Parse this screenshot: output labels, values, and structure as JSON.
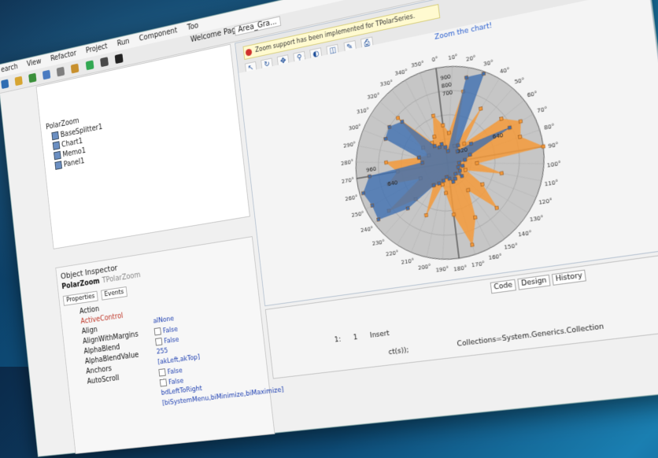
{
  "menu": [
    "earch",
    "View",
    "Refactor",
    "Project",
    "Run",
    "Component",
    "Too"
  ],
  "tabs": {
    "welcome": "Welcome Page",
    "area": "Area_Gra..."
  },
  "tree": {
    "root": "PolarZoom",
    "items": [
      "BaseSplitter1",
      "Chart1",
      "Memo1",
      "Panel1"
    ]
  },
  "inspector": {
    "title": "Object Inspector",
    "object_name": "PolarZoom",
    "object_type": "TPolarZoom",
    "tab_properties": "Properties",
    "tab_events": "Events",
    "properties": [
      {
        "name": "Action",
        "value": ""
      },
      {
        "name": "ActiveControl",
        "value": ""
      },
      {
        "name": "Align",
        "value": "alNone"
      },
      {
        "name": "AlignWithMargins",
        "value": "False"
      },
      {
        "name": "AlphaBlend",
        "value": "False"
      },
      {
        "name": "AlphaBlendValue",
        "value": "255"
      },
      {
        "name": "Anchors",
        "value": "[akLeft,akTop]"
      },
      {
        "name": "AutoScroll",
        "value": "False"
      },
      {
        "name": "",
        "value": "False"
      },
      {
        "name": "",
        "value": "bdLeftToRight"
      },
      {
        "name": "",
        "value": "[biSystemMenu,biMinimize,biMaximize]"
      }
    ]
  },
  "design": {
    "notice": "Zoom support has been implemented for TPolarSeries.",
    "zoom_title": "Zoom the chart!"
  },
  "bottom": {
    "tab_code": "Code",
    "tab_design": "Design",
    "tab_history": "History",
    "line": "1:",
    "col": "1",
    "mode": "Insert",
    "code": "ct(s));",
    "code2": "Collections=System.Generics.Collection"
  },
  "colors": {
    "orange": "#f59a3a",
    "blue": "#3f6fb0"
  },
  "chart_data": {
    "type": "polar",
    "title": "Zoom the chart!",
    "angle_labels": [
      "0°",
      "10°",
      "20°",
      "30°",
      "40°",
      "50°",
      "60°",
      "70°",
      "80°",
      "90°",
      "100°",
      "110°",
      "120°",
      "130°",
      "140°",
      "150°",
      "160°",
      "170°",
      "180°",
      "190°",
      "200°",
      "210°",
      "220°",
      "230°",
      "240°",
      "250°",
      "260°",
      "270°",
      "280°",
      "290°",
      "300°",
      "310°",
      "320°",
      "330°",
      "340°",
      "350°"
    ],
    "radial_labels": [
      "960",
      "900",
      "800",
      "700",
      "640",
      "320"
    ],
    "rmax": 960,
    "series": [
      {
        "color": "#f59a3a",
        "angles": [
          0,
          10,
          20,
          30,
          40,
          50,
          60,
          70,
          80,
          90,
          100,
          110,
          120,
          130,
          140,
          150,
          160,
          170,
          180,
          190,
          200,
          210,
          220,
          230,
          240,
          250,
          260,
          270,
          280,
          290,
          300,
          310,
          320,
          330,
          340,
          350
        ],
        "values": [
          380,
          300,
          720,
          180,
          620,
          250,
          680,
          820,
          760,
          960,
          300,
          560,
          200,
          420,
          680,
          350,
          620,
          860,
          520,
          300,
          220,
          560,
          260,
          480,
          760,
          310,
          640,
          520,
          640,
          300,
          210,
          300,
          700,
          260,
          300,
          500
        ]
      },
      {
        "color": "#3f6fb0",
        "angles": [
          0,
          10,
          20,
          30,
          40,
          50,
          60,
          70,
          80,
          90,
          100,
          110,
          120,
          130,
          140,
          150,
          160,
          170,
          180,
          190,
          200,
          210,
          220,
          230,
          240,
          250,
          260,
          270,
          280,
          290,
          300,
          310,
          320,
          330,
          340,
          350
        ],
        "values": [
          160,
          120,
          860,
          940,
          200,
          150,
          300,
          700,
          240,
          180,
          120,
          160,
          120,
          150,
          200,
          140,
          180,
          200,
          160,
          140,
          180,
          220,
          260,
          600,
          900,
          880,
          920,
          820,
          260,
          300,
          700,
          720,
          640,
          220,
          180,
          200
        ]
      }
    ]
  }
}
